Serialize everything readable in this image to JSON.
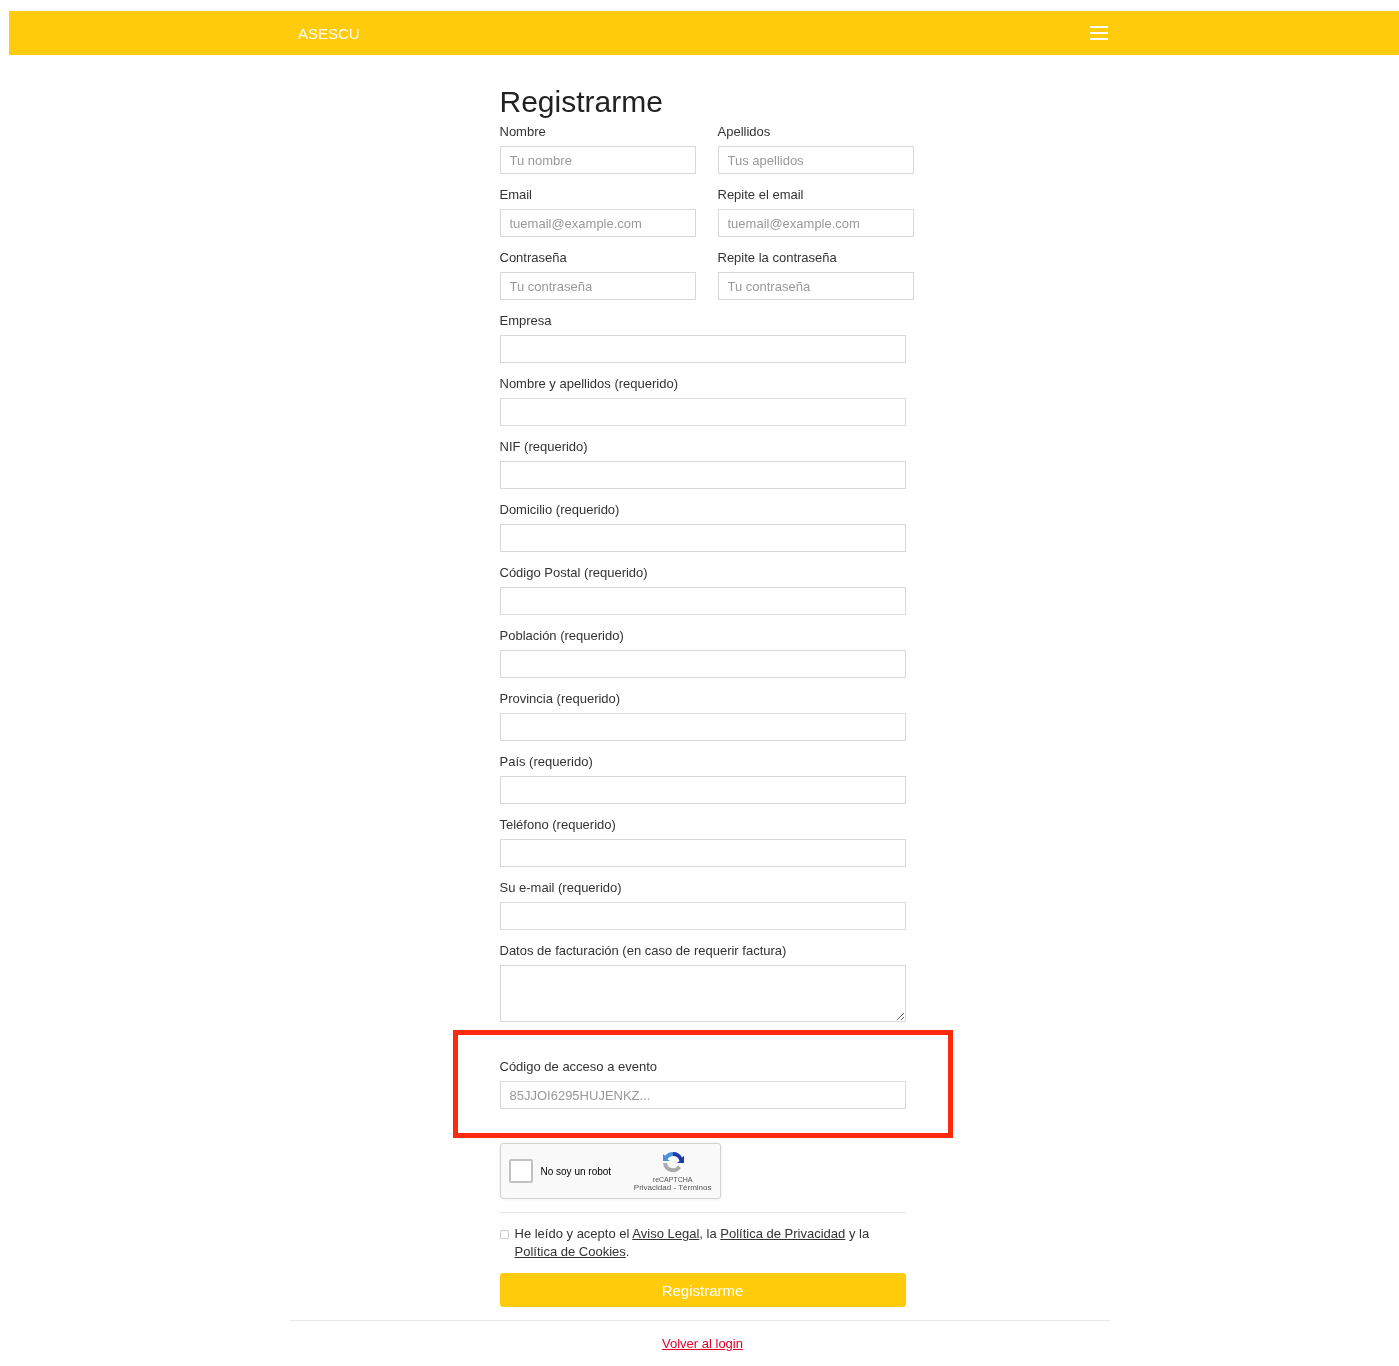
{
  "header": {
    "brand": "ASESCU"
  },
  "form": {
    "title": "Registrarme",
    "rows": [
      [
        {
          "label": "Nombre",
          "placeholder": "Tu nombre",
          "kind": "input"
        },
        {
          "label": "Apellidos",
          "placeholder": "Tus apellidos",
          "kind": "input"
        }
      ],
      [
        {
          "label": "Email",
          "placeholder": "tuemail@example.com",
          "kind": "input"
        },
        {
          "label": "Repite el email",
          "placeholder": "tuemail@example.com",
          "kind": "input"
        }
      ],
      [
        {
          "label": "Contraseña",
          "placeholder": "Tu contraseña",
          "kind": "input"
        },
        {
          "label": "Repite la contraseña",
          "placeholder": "Tu contraseña",
          "kind": "input"
        }
      ],
      [
        {
          "label": "Empresa",
          "kind": "input"
        }
      ],
      [
        {
          "label": "Nombre y apellidos (requerido)",
          "kind": "input"
        }
      ],
      [
        {
          "label": "NIF (requerido)",
          "kind": "input"
        }
      ],
      [
        {
          "label": "Domicilio (requerido)",
          "kind": "input"
        }
      ],
      [
        {
          "label": "Código Postal (requerido)",
          "kind": "input"
        }
      ],
      [
        {
          "label": "Población (requerido)",
          "kind": "input"
        }
      ],
      [
        {
          "label": "Provincia (requerido)",
          "kind": "input"
        }
      ],
      [
        {
          "label": "País (requerido)",
          "kind": "input"
        }
      ],
      [
        {
          "label": "Teléfono (requerido)",
          "kind": "input"
        }
      ],
      [
        {
          "label": "Su e-mail (requerido)",
          "kind": "input"
        }
      ],
      [
        {
          "label": "Datos de facturación (en caso de requerir factura)",
          "kind": "textarea"
        }
      ],
      [
        {
          "label": "Código de acceso a evento",
          "placeholder": "85JJOI6295HUJENKZ...",
          "kind": "input",
          "highlighted": true
        }
      ]
    ],
    "captcha": {
      "label": "No soy un robot",
      "checked": false,
      "brand": "reCAPTCHA",
      "links": "Privacidad - Términos"
    },
    "terms": {
      "checked": false,
      "parts": [
        {
          "text": "He leído y acepto el "
        },
        {
          "text": "Aviso Legal",
          "link": true
        },
        {
          "text": ", la "
        },
        {
          "text": "Política de Privacidad",
          "link": true
        },
        {
          "text": " y la "
        },
        {
          "text": "Política de Cookies",
          "link": true
        },
        {
          "text": "."
        }
      ]
    },
    "submit": "Registrarme"
  },
  "footer": {
    "link": "Volver al login"
  }
}
